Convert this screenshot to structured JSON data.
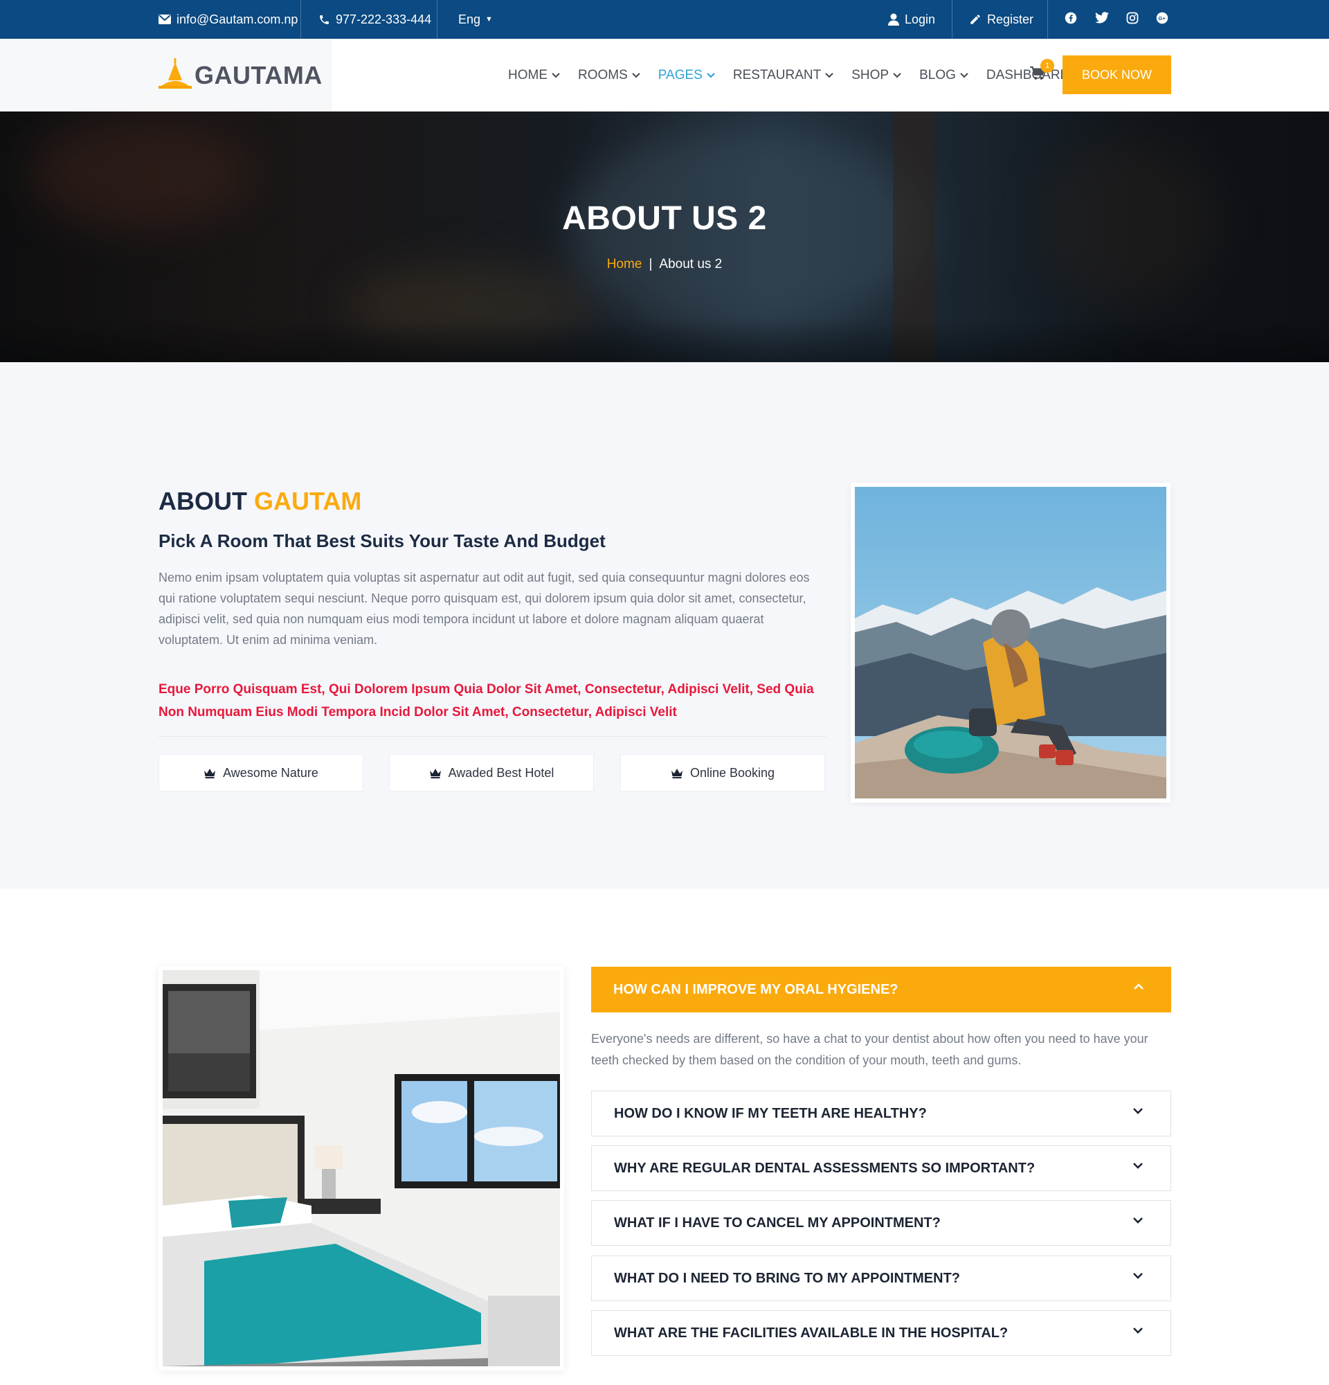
{
  "topbar": {
    "email": "info@Gautam.com.np",
    "phone": "977-222-333-444",
    "language": "Eng",
    "login": "Login",
    "register": "Register",
    "social": [
      "facebook-icon",
      "twitter-icon",
      "instagram-icon",
      "google-plus-icon"
    ]
  },
  "brand": {
    "name": "GAUTAMA"
  },
  "nav": {
    "items": [
      {
        "label": "HOME",
        "active": false
      },
      {
        "label": "ROOMS",
        "active": false
      },
      {
        "label": "PAGES",
        "active": true
      },
      {
        "label": "RESTAURANT",
        "active": false
      },
      {
        "label": "SHOP",
        "active": false
      },
      {
        "label": "BLOG",
        "active": false
      },
      {
        "label": "DASHBOARD",
        "active": false
      }
    ],
    "cart_count": "1",
    "book_now": "BOOK NOW"
  },
  "hero": {
    "title": "ABOUT US 2",
    "breadcrumb_home": "Home",
    "breadcrumb_sep": "|",
    "breadcrumb_current": "About us 2"
  },
  "about": {
    "heading_dark": "ABOUT",
    "heading_accent": "GAUTAM",
    "subheading": "Pick A Room That Best Suits Your Taste And Budget",
    "paragraph": "Nemo enim ipsam voluptatem quia voluptas sit aspernatur aut odit aut fugit, sed quia consequuntur magni dolores eos qui ratione voluptatem sequi nesciunt. Neque porro quisquam est, qui dolorem ipsum quia dolor sit amet, consectetur, adipisci velit, sed quia non numquam eius modi tempora incidunt ut labore et dolore magnam aliquam quaerat voluptatem. Ut enim ad minima veniam.",
    "highlight": "Eque Porro Quisquam Est, Qui Dolorem Ipsum Quia Dolor Sit Amet, Consectetur, Adipisci Velit, Sed Quia Non Numquam Eius Modi Tempora Incid Dolor Sit Amet, Consectetur, Adipisci Velit",
    "features": [
      "Awesome Nature",
      "Awaded Best Hotel",
      "Online Booking"
    ]
  },
  "faq": {
    "open_question": "HOW CAN I IMPROVE MY ORAL HYGIENE?",
    "open_answer": "Everyone's needs are different, so have a chat to your dentist about how often you need to have your teeth checked by them based on the condition of your mouth, teeth and gums.",
    "questions": [
      "HOW DO I KNOW IF MY TEETH ARE HEALTHY?",
      "WHY ARE REGULAR DENTAL ASSESSMENTS SO IMPORTANT?",
      "WHAT IF I HAVE TO CANCEL MY APPOINTMENT?",
      "WHAT DO I NEED TO BRING TO MY APPOINTMENT?",
      "WHAT ARE THE FACILITIES AVAILABLE IN THE HOSPITAL?"
    ]
  },
  "colors": {
    "topbar": "#0b4a82",
    "accent": "#fbaa0d",
    "nav_active": "#2ea3d6",
    "highlight_red": "#e8173b",
    "heading": "#1c2b44"
  }
}
